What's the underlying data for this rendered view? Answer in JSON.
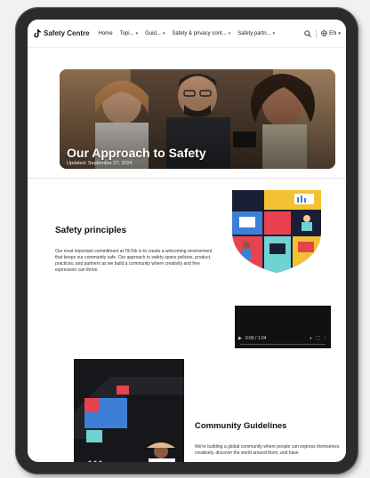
{
  "nav": {
    "brand": "Safety Centre",
    "items": [
      {
        "label": "Home",
        "dropdown": false
      },
      {
        "label": "Topi...",
        "dropdown": true
      },
      {
        "label": "Guid...",
        "dropdown": true
      },
      {
        "label": "Safety & privacy cont...",
        "dropdown": true
      },
      {
        "label": "Safety partn...",
        "dropdown": true
      }
    ],
    "language": "EN"
  },
  "hero": {
    "title": "Our Approach to Safety",
    "updated": "Updated: September 27, 2024"
  },
  "principles": {
    "heading": "Safety principles",
    "body": "Our most important commitment at TikTok is to create a welcoming environment that keeps our community safe. Our approach to safety spans policies, product, practices, and partners as we build a community where creativity and free expression can thrive."
  },
  "video": {
    "time": "0:00 / 1:04"
  },
  "guidelines": {
    "heading": "Community Guidelines",
    "body": "We're building a global community where people can express themselves creatively, discover the world around them, and have"
  },
  "colors": {
    "frame": "#2b2b2d",
    "red": "#e8424f",
    "yellow": "#f3c233",
    "blue": "#3d7fd6",
    "teal": "#6fd3d3"
  }
}
